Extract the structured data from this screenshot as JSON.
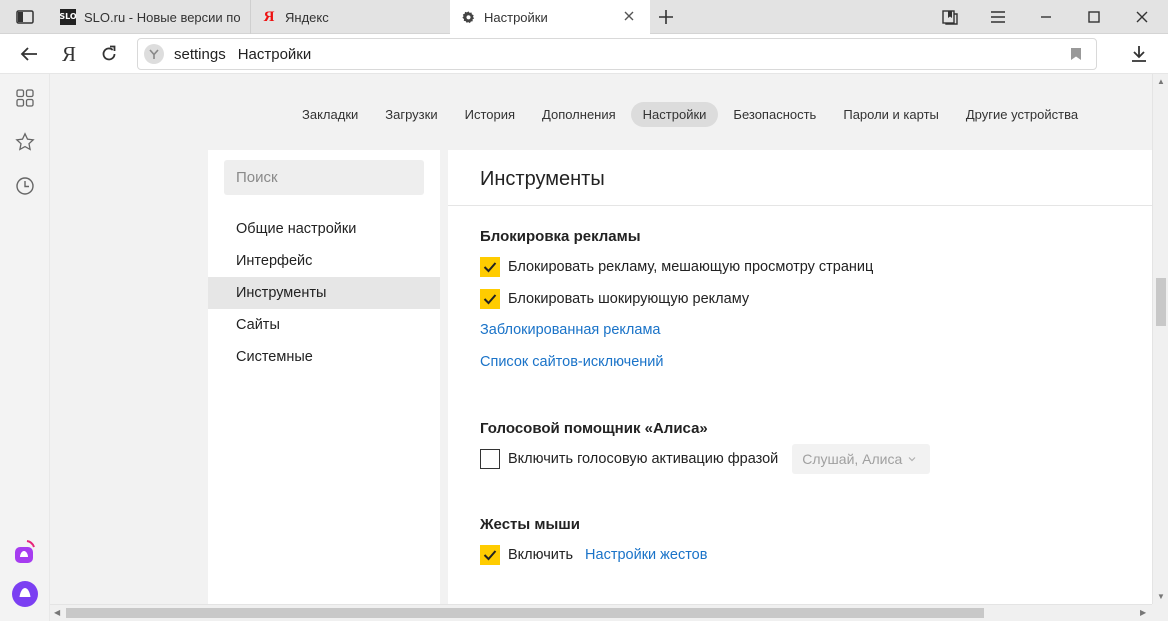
{
  "tabs": [
    {
      "title": "SLO.ru - Новые версии пог",
      "favicon": "SLO"
    },
    {
      "title": "Яндекс",
      "favicon": "Я"
    },
    {
      "title": "Настройки",
      "favicon": "gear-icon"
    }
  ],
  "address_bar": {
    "host": "settings",
    "title": "Настройки"
  },
  "settings_nav": [
    "Закладки",
    "Загрузки",
    "История",
    "Дополнения",
    "Настройки",
    "Безопасность",
    "Пароли и карты",
    "Другие устройства"
  ],
  "settings_nav_active": "Настройки",
  "search": {
    "placeholder": "Поиск"
  },
  "menu": [
    "Общие настройки",
    "Интерфейс",
    "Инструменты",
    "Сайты",
    "Системные"
  ],
  "menu_active": "Инструменты",
  "panel": {
    "title": "Инструменты",
    "ad_block": {
      "title": "Блокировка рекламы",
      "option1": {
        "label": "Блокировать рекламу, мешающую просмотру страниц",
        "checked": true
      },
      "option2": {
        "label": "Блокировать шокирующую рекламу",
        "checked": true
      },
      "link1": "Заблокированная реклама",
      "link2": "Список сайтов-исключений"
    },
    "alice": {
      "title": "Голосовой помощник «Алиса»",
      "option": {
        "label": "Включить голосовую активацию фразой",
        "checked": false
      },
      "phrase_select": "Слушай, Алиса"
    },
    "mouse_gestures": {
      "title": "Жесты мыши",
      "option": {
        "label": "Включить",
        "checked": true
      },
      "link": "Настройки жестов"
    }
  },
  "colors": {
    "accent_checkbox": "#ffcc00",
    "link": "#1a73c8",
    "alice_purple": "#7b3ff2",
    "alice_pink": "#e6247a"
  }
}
